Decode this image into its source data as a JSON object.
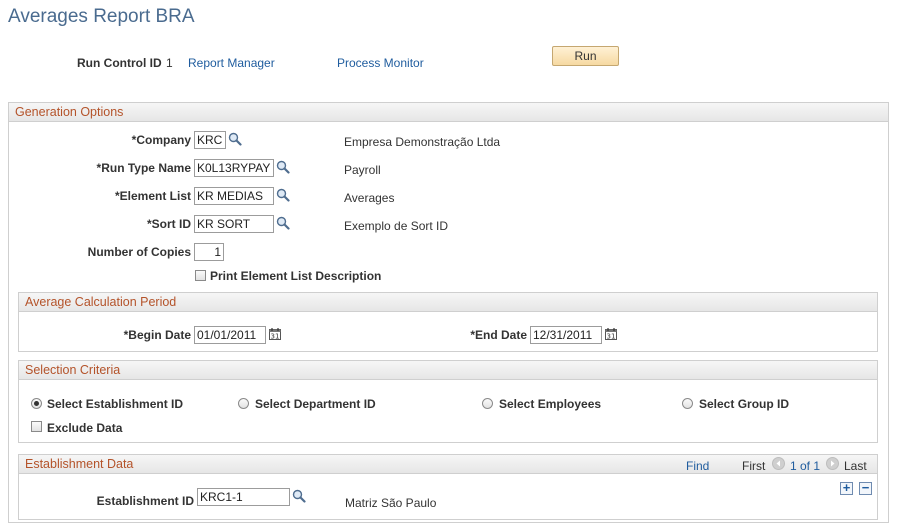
{
  "page": {
    "title": "Averages Report BRA"
  },
  "header": {
    "run_control_label": "Run Control ID",
    "run_control_value": "1",
    "report_manager": "Report Manager",
    "process_monitor": "Process Monitor",
    "run_button": "Run"
  },
  "generation": {
    "title": "Generation Options",
    "company": {
      "label": "*Company",
      "value": "KRC",
      "desc": "Empresa Demonstração Ltda"
    },
    "run_type": {
      "label": "*Run Type Name",
      "value": "K0L13RYPAY",
      "desc": "Payroll"
    },
    "element_list": {
      "label": "*Element List",
      "value": "KR MEDIAS",
      "desc": "Averages"
    },
    "sort_id": {
      "label": "*Sort ID",
      "value": "KR SORT",
      "desc": "Exemplo de Sort ID"
    },
    "copies": {
      "label": "Number of Copies",
      "value": "1"
    },
    "print_desc": {
      "label": "Print Element List Description",
      "checked": false
    }
  },
  "period": {
    "title": "Average Calculation Period",
    "begin": {
      "label": "*Begin Date",
      "value": "01/01/2011"
    },
    "end": {
      "label": "*End Date",
      "value": "12/31/2011"
    }
  },
  "criteria": {
    "title": "Selection Criteria",
    "options": [
      {
        "label": "Select Establishment ID",
        "selected": true
      },
      {
        "label": "Select Department ID",
        "selected": false
      },
      {
        "label": "Select Employees",
        "selected": false
      },
      {
        "label": "Select Group ID",
        "selected": false
      }
    ],
    "exclude": {
      "label": "Exclude Data",
      "checked": false
    }
  },
  "establishment": {
    "title": "Establishment Data",
    "find": "Find",
    "first": "First",
    "range": "1 of 1",
    "last": "Last",
    "id_label": "Establishment ID",
    "id_value": "KRC1-1",
    "desc": "Matriz São Paulo"
  }
}
